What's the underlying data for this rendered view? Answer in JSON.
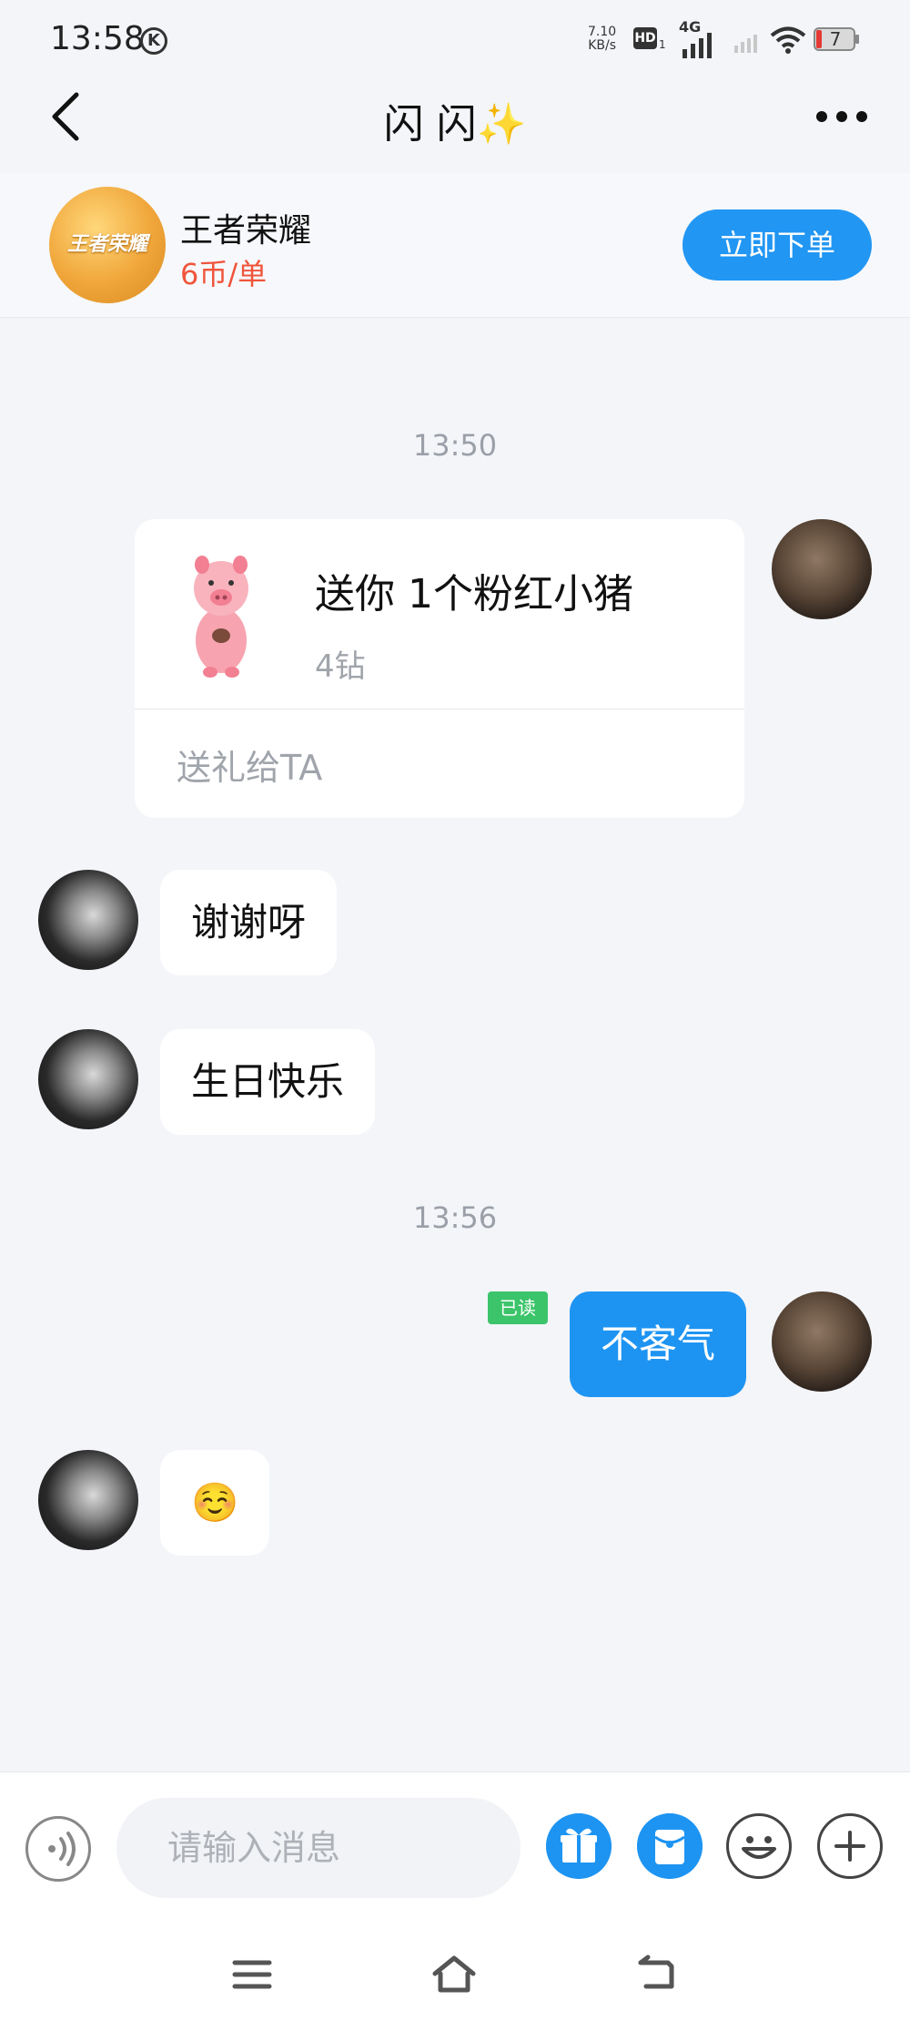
{
  "status_bar": {
    "time": "13:58",
    "k_badge": "K",
    "net_speed_value": "7.10",
    "net_speed_unit": "KB/s",
    "hd_label": "HD",
    "hd_sub": "1",
    "signal_label": "4G",
    "battery_level": "7"
  },
  "header": {
    "title": "闪 闪✨",
    "back_icon": "chevron-left-icon",
    "more_icon": "more-dots-icon"
  },
  "game": {
    "logo_text": "王者荣耀",
    "name": "王者荣耀",
    "price": "6币/单",
    "order_label": "立即下单"
  },
  "messages": {
    "time_1": "13:50",
    "gift": {
      "title": "送你 1个粉红小猪",
      "price": "4钻",
      "action": "送礼给TA"
    },
    "msg_thanks": "谢谢呀",
    "msg_birthday": "生日快乐",
    "time_2": "13:56",
    "read_badge": "已读",
    "msg_welcome": "不客气",
    "msg_emoji": "☺️"
  },
  "input": {
    "placeholder": "请输入消息"
  },
  "colors": {
    "accent": "#1e94f2",
    "price": "#f0553b",
    "read": "#3cc46a"
  }
}
